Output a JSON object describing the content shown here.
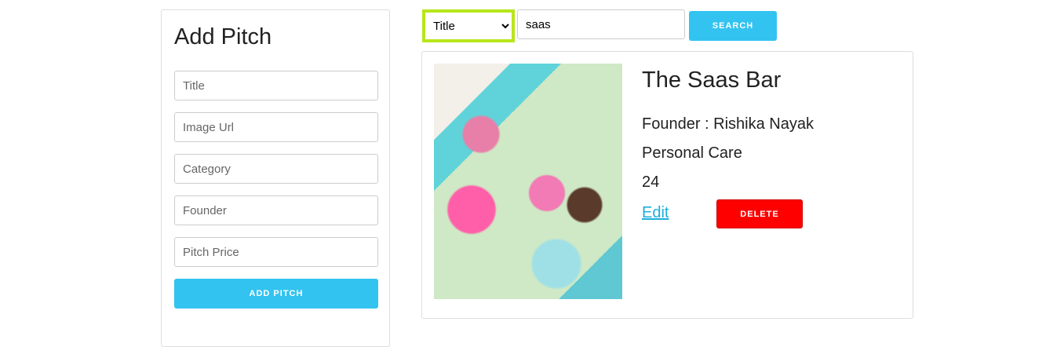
{
  "form": {
    "title": "Add Pitch",
    "fields": [
      {
        "placeholder": "Title"
      },
      {
        "placeholder": "Image Url"
      },
      {
        "placeholder": "Category"
      },
      {
        "placeholder": "Founder"
      },
      {
        "placeholder": "Pitch Price"
      }
    ],
    "submit_label": "ADD PITCH"
  },
  "search": {
    "filter_selected": "Title",
    "query": "saas",
    "button_label": "SEARCH"
  },
  "result": {
    "title": "The Saas Bar",
    "founder": "Founder : Rishika Nayak",
    "category": "Personal Care",
    "price": "24",
    "edit_label": "Edit",
    "delete_label": "DELETE"
  }
}
